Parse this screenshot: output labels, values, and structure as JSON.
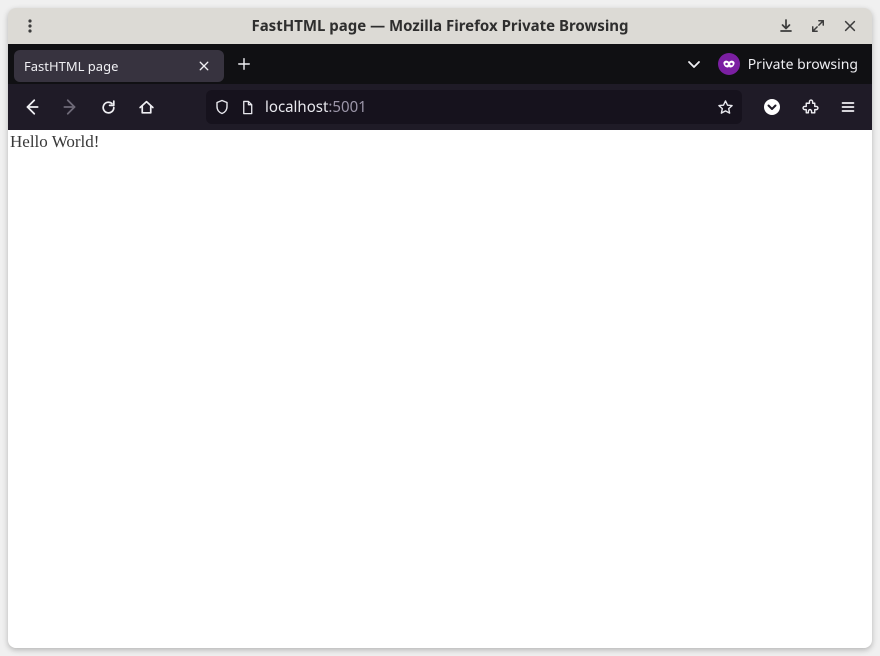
{
  "window": {
    "title": "FastHTML page — Mozilla Firefox Private Browsing"
  },
  "tabs": {
    "items": [
      {
        "label": "FastHTML page"
      }
    ]
  },
  "private": {
    "label": "Private browsing"
  },
  "address": {
    "host": "localhost",
    "port": ":5001"
  },
  "page": {
    "body": "Hello World!"
  }
}
